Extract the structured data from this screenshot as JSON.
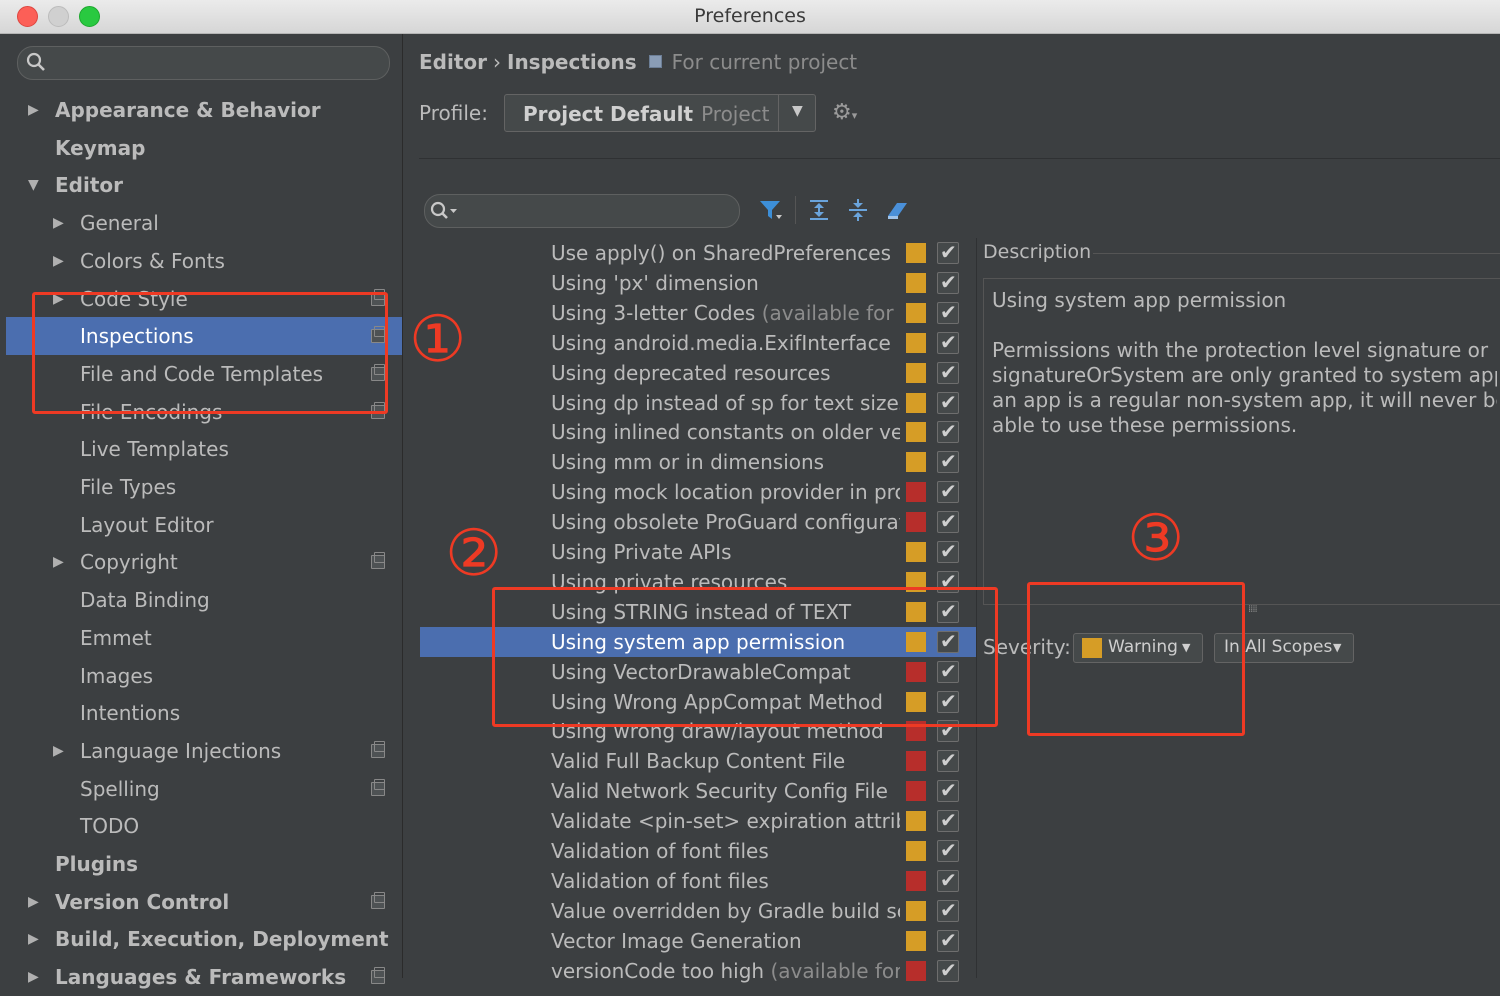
{
  "window": {
    "title": "Preferences"
  },
  "sidebar": {
    "items": [
      {
        "label": "Appearance & Behavior",
        "bold": true,
        "level": 0,
        "expander": "collapsed",
        "project_icon": false
      },
      {
        "label": "Keymap",
        "bold": true,
        "level": 0,
        "expander": "none",
        "project_icon": false
      },
      {
        "label": "Editor",
        "bold": true,
        "level": 0,
        "expander": "expanded",
        "project_icon": false
      },
      {
        "label": "General",
        "bold": false,
        "level": 1,
        "expander": "collapsed",
        "project_icon": false
      },
      {
        "label": "Colors & Fonts",
        "bold": false,
        "level": 1,
        "expander": "collapsed",
        "project_icon": false
      },
      {
        "label": "Code Style",
        "bold": false,
        "level": 1,
        "expander": "collapsed",
        "project_icon": true
      },
      {
        "label": "Inspections",
        "bold": false,
        "level": 1,
        "expander": "none",
        "project_icon": true,
        "selected": true
      },
      {
        "label": "File and Code Templates",
        "bold": false,
        "level": 1,
        "expander": "none",
        "project_icon": true
      },
      {
        "label": "File Encodings",
        "bold": false,
        "level": 1,
        "expander": "none",
        "project_icon": true
      },
      {
        "label": "Live Templates",
        "bold": false,
        "level": 1,
        "expander": "none",
        "project_icon": false
      },
      {
        "label": "File Types",
        "bold": false,
        "level": 1,
        "expander": "none",
        "project_icon": false
      },
      {
        "label": "Layout Editor",
        "bold": false,
        "level": 1,
        "expander": "none",
        "project_icon": false
      },
      {
        "label": "Copyright",
        "bold": false,
        "level": 1,
        "expander": "collapsed",
        "project_icon": true
      },
      {
        "label": "Data Binding",
        "bold": false,
        "level": 1,
        "expander": "none",
        "project_icon": false
      },
      {
        "label": "Emmet",
        "bold": false,
        "level": 1,
        "expander": "none",
        "project_icon": false
      },
      {
        "label": "Images",
        "bold": false,
        "level": 1,
        "expander": "none",
        "project_icon": false
      },
      {
        "label": "Intentions",
        "bold": false,
        "level": 1,
        "expander": "none",
        "project_icon": false
      },
      {
        "label": "Language Injections",
        "bold": false,
        "level": 1,
        "expander": "collapsed",
        "project_icon": true
      },
      {
        "label": "Spelling",
        "bold": false,
        "level": 1,
        "expander": "none",
        "project_icon": true
      },
      {
        "label": "TODO",
        "bold": false,
        "level": 1,
        "expander": "none",
        "project_icon": false
      },
      {
        "label": "Plugins",
        "bold": true,
        "level": 0,
        "expander": "none",
        "project_icon": false
      },
      {
        "label": "Version Control",
        "bold": true,
        "level": 0,
        "expander": "collapsed",
        "project_icon": true
      },
      {
        "label": "Build, Execution, Deployment",
        "bold": true,
        "level": 0,
        "expander": "collapsed",
        "project_icon": false
      },
      {
        "label": "Languages & Frameworks",
        "bold": true,
        "level": 0,
        "expander": "collapsed",
        "project_icon": true
      }
    ]
  },
  "header": {
    "breadcrumb": {
      "part1": "Editor",
      "separator": "›",
      "part2": "Inspections",
      "scope": "For current project"
    },
    "profile": {
      "label": "Profile:",
      "name": "Project Default",
      "type": "Project"
    }
  },
  "toolbar": {
    "icons": [
      "filter-icon",
      "expand-all-icon",
      "collapse-all-icon",
      "reset-icon"
    ]
  },
  "colors": {
    "warning": "#d69d26",
    "error": "#b72e2b",
    "selection": "#4b6eaf",
    "annotation": "#ee3a24"
  },
  "inspections": [
    {
      "name": "Use apply() on SharedPreferences",
      "hint": "",
      "severity": "warning"
    },
    {
      "name": "Using 'px' dimension",
      "hint": "",
      "severity": "warning"
    },
    {
      "name": "Using 3-letter Codes",
      "hint": "(available for A",
      "severity": "warning"
    },
    {
      "name": "Using android.media.ExifInterface",
      "hint": "",
      "severity": "warning"
    },
    {
      "name": "Using deprecated resources",
      "hint": "",
      "severity": "warning"
    },
    {
      "name": "Using dp instead of sp for text sizes",
      "hint": "",
      "severity": "warning"
    },
    {
      "name": "Using inlined constants on older ver",
      "hint": "",
      "severity": "warning"
    },
    {
      "name": "Using mm or in dimensions",
      "hint": "",
      "severity": "warning"
    },
    {
      "name": "Using mock location provider in pro",
      "hint": "",
      "severity": "error"
    },
    {
      "name": "Using obsolete ProGuard configurat",
      "hint": "",
      "severity": "error"
    },
    {
      "name": "Using Private APIs",
      "hint": "",
      "severity": "warning"
    },
    {
      "name": "Using private resources",
      "hint": "",
      "severity": "warning"
    },
    {
      "name": "Using STRING instead of TEXT",
      "hint": "",
      "severity": "warning"
    },
    {
      "name": "Using system app permission",
      "hint": "",
      "severity": "warning",
      "selected": true
    },
    {
      "name": "Using VectorDrawableCompat",
      "hint": "",
      "severity": "error"
    },
    {
      "name": "Using Wrong AppCompat Method",
      "hint": "",
      "severity": "warning"
    },
    {
      "name": "Using wrong draw/layout method",
      "hint": "",
      "severity": "error"
    },
    {
      "name": "Valid Full Backup Content File",
      "hint": "",
      "severity": "error"
    },
    {
      "name": "Valid Network Security Config File",
      "hint": "",
      "severity": "error"
    },
    {
      "name": "Validate <pin-set> expiration attribu",
      "hint": "",
      "severity": "warning"
    },
    {
      "name": "Validation of font files",
      "hint": "",
      "severity": "warning"
    },
    {
      "name": "Validation of font files",
      "hint": "",
      "severity": "error"
    },
    {
      "name": "Value overridden by Gradle build scr",
      "hint": "",
      "severity": "warning"
    },
    {
      "name": "Vector Image Generation",
      "hint": "",
      "severity": "warning"
    },
    {
      "name": "versionCode too high",
      "hint": "(available for A",
      "severity": "error"
    }
  ],
  "description": {
    "label": "Description",
    "title": "Using system app permission",
    "body_lines": [
      "Permissions with the protection level signature or",
      "signatureOrSystem are only granted to system apps.",
      "an app is a regular non-system app, it will never be",
      "able to use these permissions."
    ]
  },
  "severity": {
    "label": "Severity:",
    "value": "Warning",
    "scope": "In All Scopes"
  },
  "annotations": {
    "one": "①",
    "two": "②",
    "three": "③"
  }
}
